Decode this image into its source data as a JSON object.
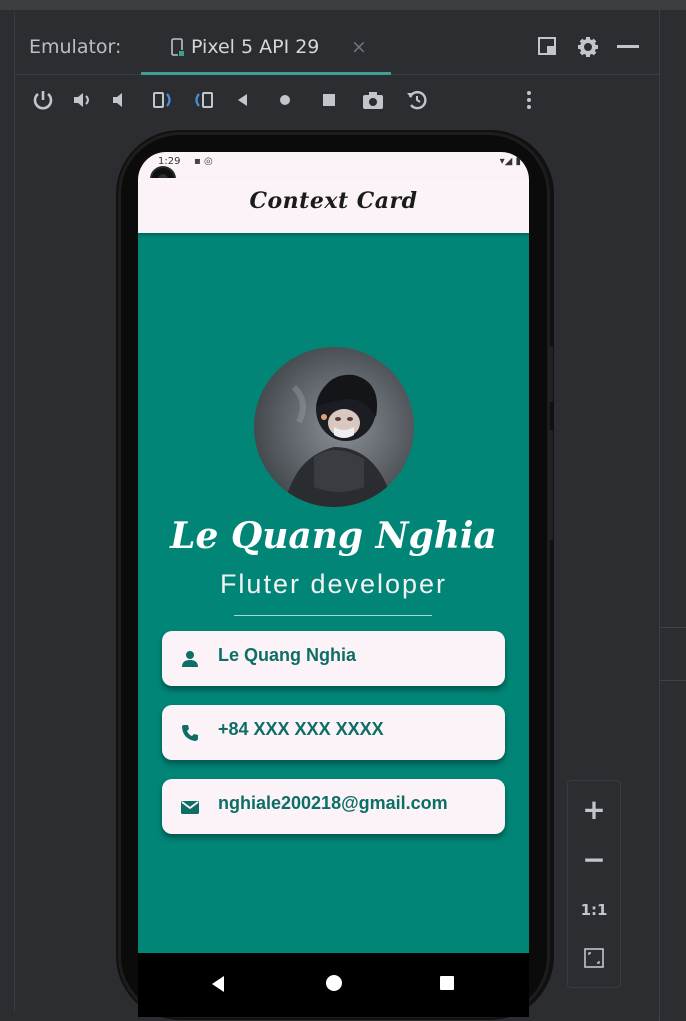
{
  "window": {
    "emulator_label": "Emulator:",
    "tab": {
      "label": "Pixel 5 API 29",
      "close": "×",
      "device_icon": "device-icon"
    },
    "window_icons": [
      "restore-icon",
      "gear-icon",
      "minimize-icon"
    ]
  },
  "toolbar": {
    "buttons": [
      "power-icon",
      "volume-up-icon",
      "volume-down-icon",
      "rotate-left-icon",
      "rotate-right-icon",
      "back-icon",
      "home-icon",
      "overview-icon",
      "camera-icon",
      "snapshot-icon",
      "more-icon"
    ]
  },
  "device": {
    "status": {
      "time": "1:29",
      "left_icons": "▪ ◎",
      "right_icons": "▾◢ ▮"
    },
    "appbar": {
      "title": "Context Card"
    },
    "profile": {
      "name": "Le Quang Nghia",
      "role": "Fluter developer"
    },
    "cards": [
      {
        "icon": "person-icon",
        "text": "Le Quang Nghia"
      },
      {
        "icon": "phone-icon",
        "text": "+84 XXX XXX XXXX"
      },
      {
        "icon": "email-icon",
        "text": "nghiale200218@gmail.com"
      }
    ],
    "colors": {
      "background": "#008577",
      "card": "#fbf3f7",
      "card_text": "#0d6e66"
    }
  },
  "zoom": {
    "plus": "+",
    "minus": "−",
    "one_to_one": "1:1"
  }
}
